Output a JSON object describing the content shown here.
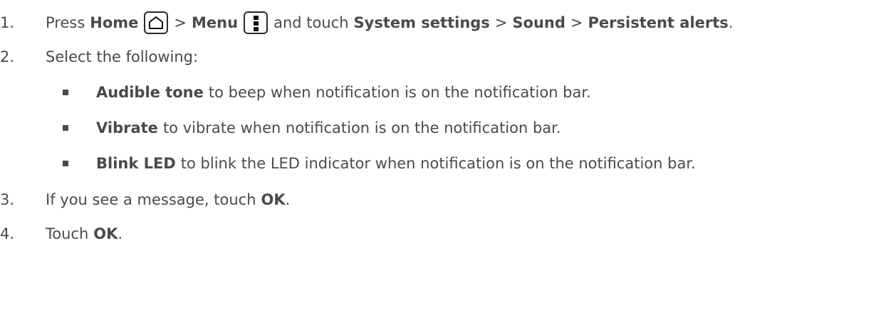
{
  "steps": [
    {
      "num": "1.",
      "parts": {
        "p1": "Press",
        "home": "Home",
        "gt1": ">",
        "menu": "Menu",
        "p2": "and touch",
        "system_settings": "System settings",
        "gt2": ">",
        "sound": "Sound",
        "gt3": ">",
        "persistent_alerts": "Persistent alerts",
        "end": "."
      },
      "icons": [
        "home-icon",
        "menu-icon"
      ]
    },
    {
      "num": "2.",
      "text": "Select the following:"
    },
    {
      "num": "3.",
      "pre": "If you see a message, touch",
      "bold": "OK",
      "end": "."
    },
    {
      "num": "4.",
      "pre": "Touch",
      "bold": "OK",
      "end": "."
    }
  ],
  "options": [
    {
      "bold": "Audible tone",
      "text": "to beep when notification is on the notification bar."
    },
    {
      "bold": "Vibrate",
      "text": "to vibrate when notification is on the notification bar."
    },
    {
      "bold": "Blink LED",
      "text": "to blink the LED indicator when notification is on the notification bar."
    }
  ]
}
